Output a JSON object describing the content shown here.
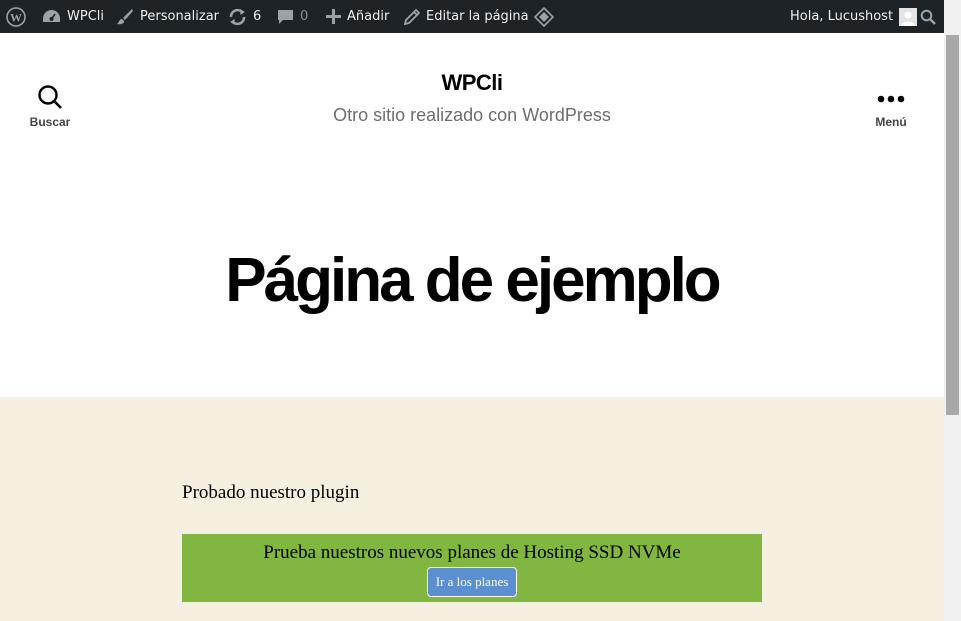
{
  "admin_bar": {
    "wp_logo_icon": "wordpress-icon",
    "site_name": "WPCli",
    "customize": "Personalizar",
    "updates_count": "6",
    "comments_count": "0",
    "new_label": "Añadir",
    "edit_label": "Editar la página",
    "greeting": "Hola, Lucushost"
  },
  "header": {
    "search_label": "Buscar",
    "site_title": "WPCli",
    "site_description": "Otro sitio realizado con WordPress",
    "menu_label": "Menú"
  },
  "entry": {
    "title": "Página de ejemplo"
  },
  "content": {
    "paragraph": "Probado nuestro plugin",
    "promo_text": "Prueba nuestros nuevos planes de Hosting SSD NVMe",
    "promo_button": "Ir a los planes"
  },
  "colors": {
    "admin_bar_bg": "#1d2327",
    "content_bg": "#f5efe0",
    "promo_bg": "#81b740",
    "promo_button_bg": "#5b8fd0"
  }
}
